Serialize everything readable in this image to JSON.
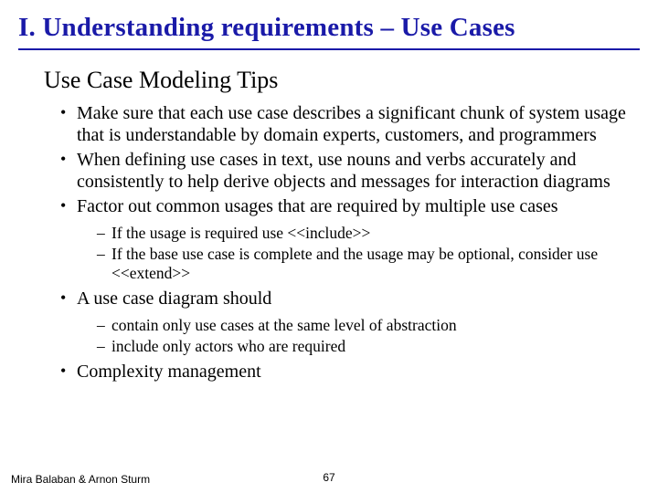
{
  "title": "I. Understanding requirements – Use Cases",
  "section_heading": "Use Case Modeling Tips",
  "bullets": {
    "b0": "Make sure that each use case describes a significant chunk of system usage that is understandable by domain experts, customers, and programmers",
    "b1": "When defining use cases in text, use nouns and verbs accurately and consistently to help derive objects and messages for interaction diagrams",
    "b2": "Factor out common usages that are required by multiple use cases",
    "b2_sub": {
      "s0": "If the usage is required use <<include>>",
      "s1": "If the base use case is complete and the usage may be optional, consider use <<extend>>"
    },
    "b3": "A use case diagram should",
    "b3_sub": {
      "s0": "contain only use cases at the same level of abstraction",
      "s1": "include only actors who are required"
    },
    "b4": "Complexity management"
  },
  "footer": {
    "authors": "Mira Balaban  &  Arnon Sturm",
    "page": "67"
  }
}
